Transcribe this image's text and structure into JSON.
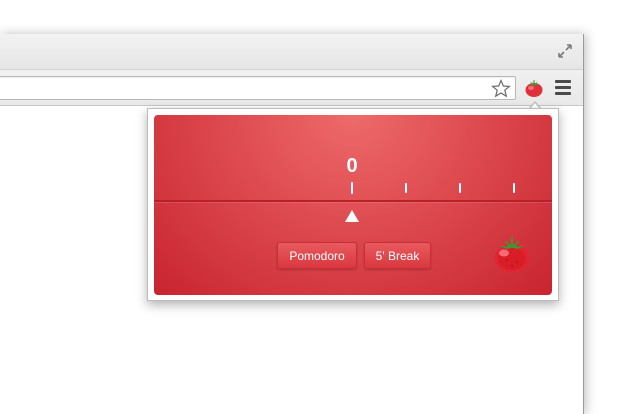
{
  "browser": {
    "icons": {
      "restore": "restore-window-icon",
      "bookmark": "star-icon",
      "extension": "tomato-icon",
      "menu": "hamburger-menu-icon"
    }
  },
  "popup": {
    "timer_value": "0",
    "buttons": {
      "pomodoro_label": "Pomodoro",
      "break_label": "5' Break"
    },
    "colors": {
      "panel_top": "#ee6a6a",
      "panel_bottom": "#c8242f",
      "button": "#dd4a4f",
      "text": "#ffffff"
    }
  }
}
